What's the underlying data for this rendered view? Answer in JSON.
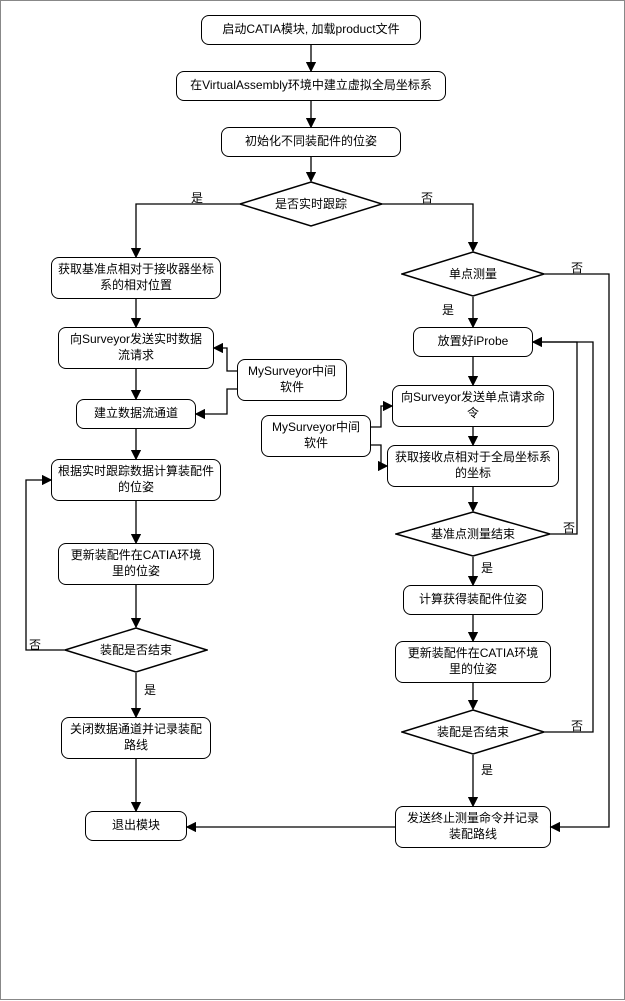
{
  "chart_data": {
    "type": "flowchart",
    "title": "",
    "nodes": [
      {
        "id": "n1",
        "shape": "process",
        "text": "启动CATIA模块, 加载product文件"
      },
      {
        "id": "n2",
        "shape": "process",
        "text": "在VirtualAssembly环境中建立虚拟全局坐标系"
      },
      {
        "id": "n3",
        "shape": "process",
        "text": "初始化不同装配件的位姿"
      },
      {
        "id": "d1",
        "shape": "decision",
        "text": "是否实时跟踪"
      },
      {
        "id": "n4",
        "shape": "process",
        "text": "获取基准点相对于接收器坐标系的相对位置"
      },
      {
        "id": "n5",
        "shape": "process",
        "text": "向Surveyor发送实时数据流请求"
      },
      {
        "id": "n6",
        "shape": "process",
        "text": "建立数据流通道"
      },
      {
        "id": "n7",
        "shape": "process",
        "text": "根据实时跟踪数据计算装配件的位姿"
      },
      {
        "id": "n8",
        "shape": "process",
        "text": "更新装配件在CATIA环境里的位姿"
      },
      {
        "id": "d2",
        "shape": "decision",
        "text": "装配是否结束"
      },
      {
        "id": "n9",
        "shape": "process",
        "text": "关闭数据通道并记录装配路线"
      },
      {
        "id": "n10",
        "shape": "process",
        "text": "退出模块"
      },
      {
        "id": "m1",
        "shape": "process",
        "text": "MySurveyor中间软件"
      },
      {
        "id": "d3",
        "shape": "decision",
        "text": "单点测量"
      },
      {
        "id": "n11",
        "shape": "process",
        "text": "放置好iProbe"
      },
      {
        "id": "n12",
        "shape": "process",
        "text": "向Surveyor发送单点请求命令"
      },
      {
        "id": "n13",
        "shape": "process",
        "text": "获取接收点相对于全局坐标系的坐标"
      },
      {
        "id": "m2",
        "shape": "process",
        "text": "MySurveyor中间软件"
      },
      {
        "id": "d4",
        "shape": "decision",
        "text": "基准点测量结束"
      },
      {
        "id": "n14",
        "shape": "process",
        "text": "计算获得装配件位姿"
      },
      {
        "id": "n15",
        "shape": "process",
        "text": "更新装配件在CATIA环境里的位姿"
      },
      {
        "id": "d5",
        "shape": "decision",
        "text": "装配是否结束"
      },
      {
        "id": "n16",
        "shape": "process",
        "text": "发送终止测量命令并记录装配路线"
      }
    ],
    "edges": [
      {
        "from": "n1",
        "to": "n2"
      },
      {
        "from": "n2",
        "to": "n3"
      },
      {
        "from": "n3",
        "to": "d1"
      },
      {
        "from": "d1",
        "to": "n4",
        "label": "是"
      },
      {
        "from": "d1",
        "to": "d3",
        "label": "否"
      },
      {
        "from": "n4",
        "to": "n5"
      },
      {
        "from": "n5",
        "to": "n6"
      },
      {
        "from": "n6",
        "to": "n7"
      },
      {
        "from": "n7",
        "to": "n8"
      },
      {
        "from": "n8",
        "to": "d2"
      },
      {
        "from": "d2",
        "to": "n9",
        "label": "是"
      },
      {
        "from": "d2",
        "to": "n7",
        "label": "否"
      },
      {
        "from": "n9",
        "to": "n10"
      },
      {
        "from": "m1",
        "to": "n5"
      },
      {
        "from": "m1",
        "to": "n6"
      },
      {
        "from": "d3",
        "to": "n11",
        "label": "是"
      },
      {
        "from": "d3",
        "to": "n16",
        "label": "否"
      },
      {
        "from": "n11",
        "to": "n12"
      },
      {
        "from": "n12",
        "to": "n13"
      },
      {
        "from": "n13",
        "to": "d4"
      },
      {
        "from": "m2",
        "to": "n12"
      },
      {
        "from": "m2",
        "to": "n13"
      },
      {
        "from": "d4",
        "to": "n14",
        "label": "是"
      },
      {
        "from": "d4",
        "to": "n11",
        "label": "否"
      },
      {
        "from": "n14",
        "to": "n15"
      },
      {
        "from": "n15",
        "to": "d5"
      },
      {
        "from": "d5",
        "to": "n16",
        "label": "是"
      },
      {
        "from": "d5",
        "to": "n11",
        "label": "否"
      },
      {
        "from": "n16",
        "to": "n10"
      }
    ]
  },
  "nodes": {
    "n1": "启动CATIA模块, 加载product文件",
    "n2": "在VirtualAssembly环境中建立虚拟全局坐标系",
    "n3": "初始化不同装配件的位姿",
    "d1": "是否实时跟踪",
    "n4": "获取基准点相对于接收器坐标系的相对位置",
    "n5": "向Surveyor发送实时数据流请求",
    "n6": "建立数据流通道",
    "n7": "根据实时跟踪数据计算装配件的位姿",
    "n8": "更新装配件在CATIA环境里的位姿",
    "d2": "装配是否结束",
    "n9": "关闭数据通道并记录装配路线",
    "n10": "退出模块",
    "m1": "MySurveyor中间软件",
    "d3": "单点测量",
    "n11": "放置好iProbe",
    "n12": "向Surveyor发送单点请求命令",
    "n13": "获取接收点相对于全局坐标系的坐标",
    "m2": "MySurveyor中间软件",
    "d4": "基准点测量结束",
    "n14": "计算获得装配件位姿",
    "n15": "更新装配件在CATIA环境里的位姿",
    "d5": "装配是否结束",
    "n16": "发送终止测量命令并记录装配路线"
  },
  "labels": {
    "yes": "是",
    "no": "否"
  }
}
